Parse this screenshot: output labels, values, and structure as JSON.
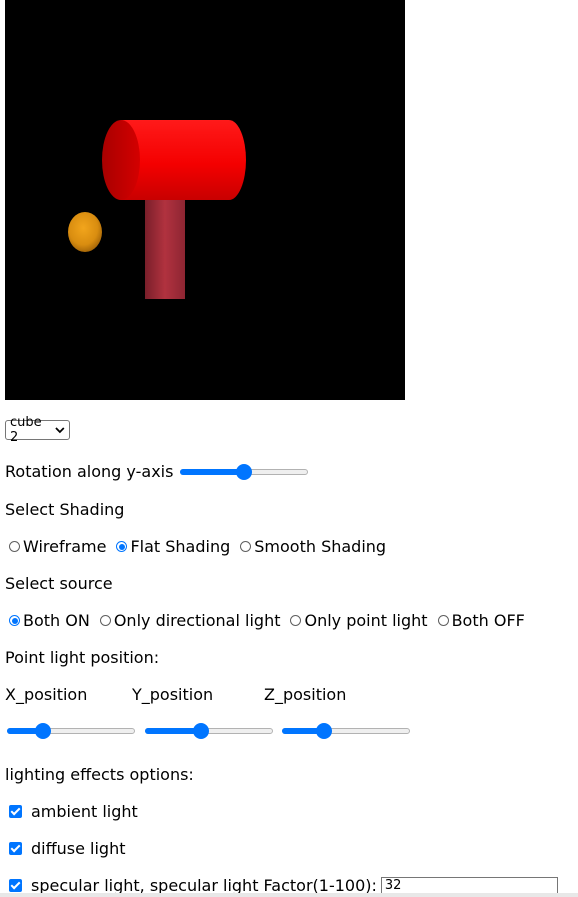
{
  "object_select": {
    "selected": "cube 2"
  },
  "rotation": {
    "label": "Rotation along y-axis",
    "value": 0.5
  },
  "shading": {
    "heading": "Select Shading",
    "options": [
      {
        "label": "Wireframe",
        "selected": false
      },
      {
        "label": "Flat Shading",
        "selected": true
      },
      {
        "label": "Smooth Shading",
        "selected": false
      }
    ]
  },
  "source": {
    "heading": "Select source",
    "options": [
      {
        "label": "Both ON",
        "selected": true
      },
      {
        "label": "Only directional light",
        "selected": false
      },
      {
        "label": "Only point light",
        "selected": false
      },
      {
        "label": "Both OFF",
        "selected": false
      }
    ]
  },
  "point_light": {
    "heading": "Point light position:",
    "x_label": "X_position",
    "y_label": "Y_position",
    "z_label": "Z_position",
    "x_value": 0.25,
    "y_value": 0.43,
    "z_value": 0.3
  },
  "lighting": {
    "heading": "lighting effects options:",
    "ambient_label": "ambient light",
    "ambient_checked": true,
    "diffuse_label": "diffuse light",
    "diffuse_checked": true,
    "specular_label": "specular light, specular light Factor(1-100):",
    "specular_checked": true,
    "specular_factor": "32"
  },
  "colors": {
    "accent": "#0075ff",
    "canvas_bg": "#000000",
    "cylinder_red": "#ff0000",
    "stand": "#9c2a35",
    "sphere": "#e09a17"
  }
}
